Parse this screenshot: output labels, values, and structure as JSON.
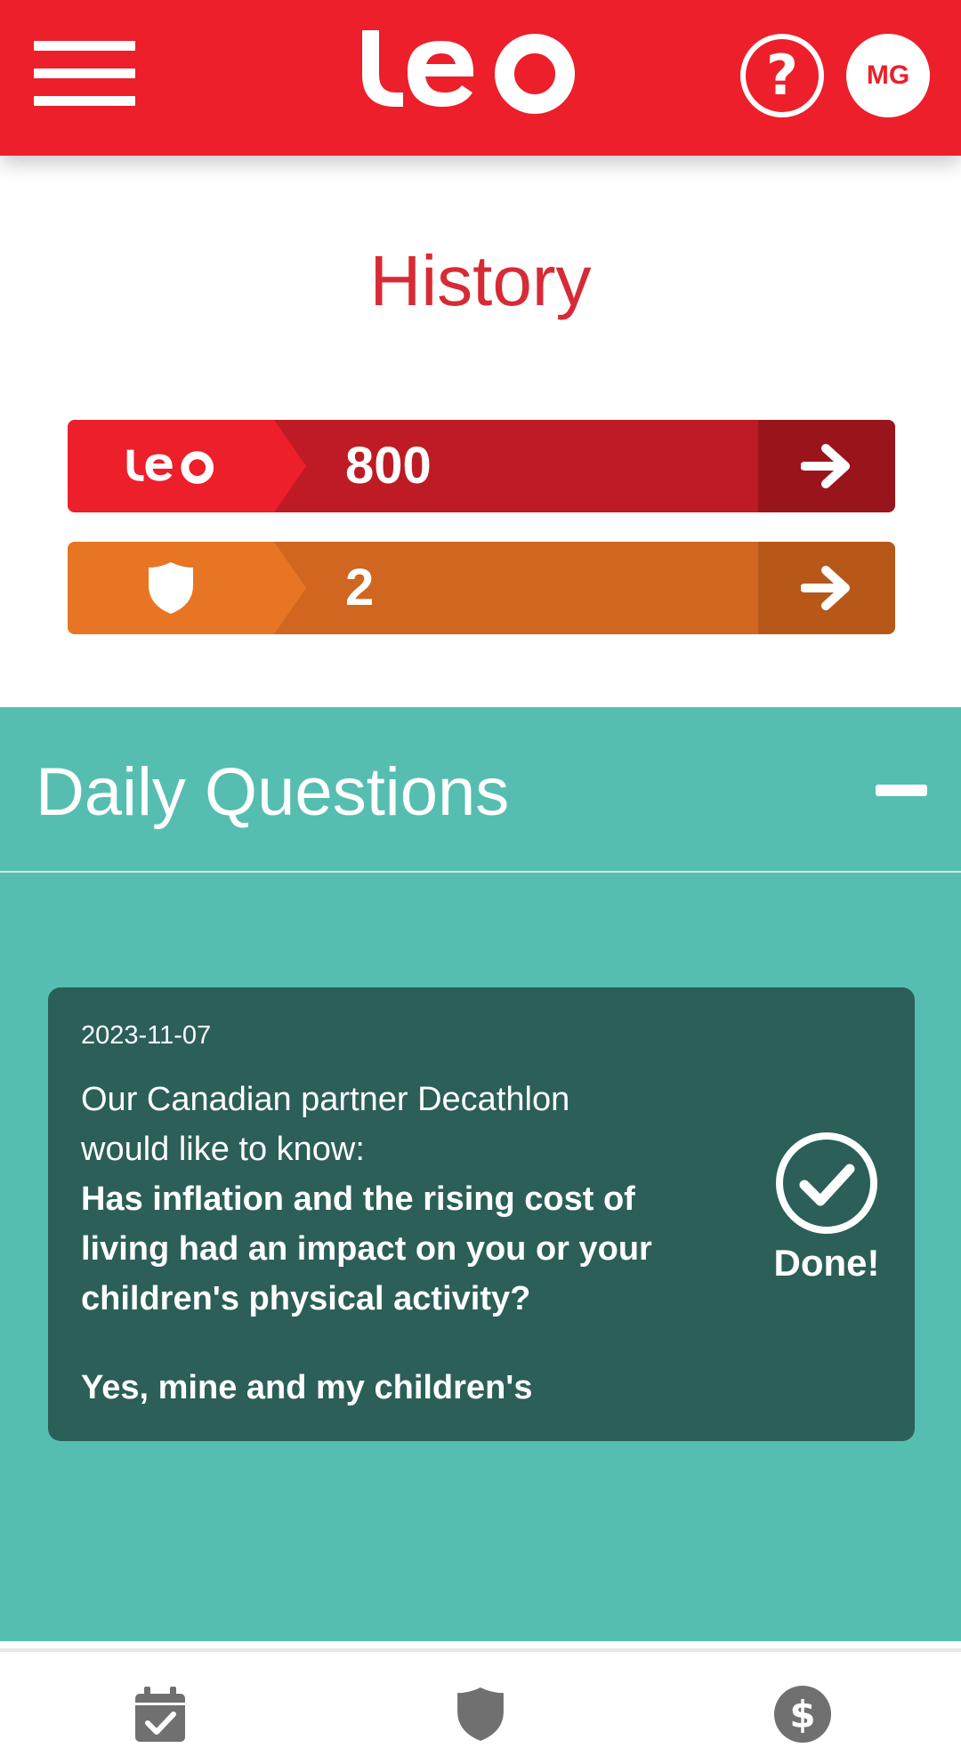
{
  "header": {
    "menu_icon": "hamburger-menu-icon",
    "logo_text": "Leo",
    "help_symbol": "?",
    "avatar_initials": "MG"
  },
  "page": {
    "title": "History"
  },
  "stats": [
    {
      "icon": "leo-logo",
      "value": "800",
      "arrow_icon": "arrow-right-icon",
      "color": "#ec1f2a"
    },
    {
      "icon": "shield-icon",
      "value": "2",
      "arrow_icon": "arrow-right-icon",
      "color": "#e87524"
    }
  ],
  "daily_questions": {
    "title": "Daily Questions",
    "toggle_icon": "minus-icon",
    "items": [
      {
        "date": "2023-11-07",
        "intro": "Our Canadian partner Decathlon would like to know:",
        "question": "Has inflation and the rising cost of living had an impact on you or your children's physical activity?",
        "answer": "Yes, mine and my children's",
        "status_label": "Done!",
        "status_icon": "check-circle-icon"
      }
    ]
  },
  "bottom_nav": [
    {
      "icon": "calendar-check-icon"
    },
    {
      "icon": "shield-icon"
    },
    {
      "icon": "dollar-circle-icon"
    }
  ],
  "colors": {
    "brand_red": "#ec1f2a",
    "orange": "#e87524",
    "teal": "#55beb0",
    "card_dark_teal": "#2b5f58",
    "nav_gray": "#707070"
  }
}
